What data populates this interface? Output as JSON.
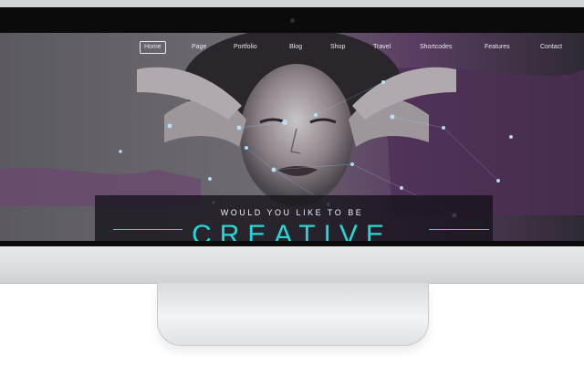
{
  "nav": {
    "items": [
      {
        "label": "Home"
      },
      {
        "label": "Page"
      },
      {
        "label": "Portfolio"
      },
      {
        "label": "Blog"
      },
      {
        "label": "Shop"
      },
      {
        "label": "Travel"
      },
      {
        "label": "Shortcodes"
      },
      {
        "label": "Features"
      },
      {
        "label": "Contact"
      }
    ],
    "active": "Home"
  },
  "hero": {
    "tagline": "WOULD YOU LIKE TO BE",
    "headline": "CREATIVE",
    "accent_color": "#25d8d8",
    "image": "portrait-particles"
  },
  "device": {
    "type": "desktop-monitor",
    "frame_color": "#d9dbdd"
  }
}
